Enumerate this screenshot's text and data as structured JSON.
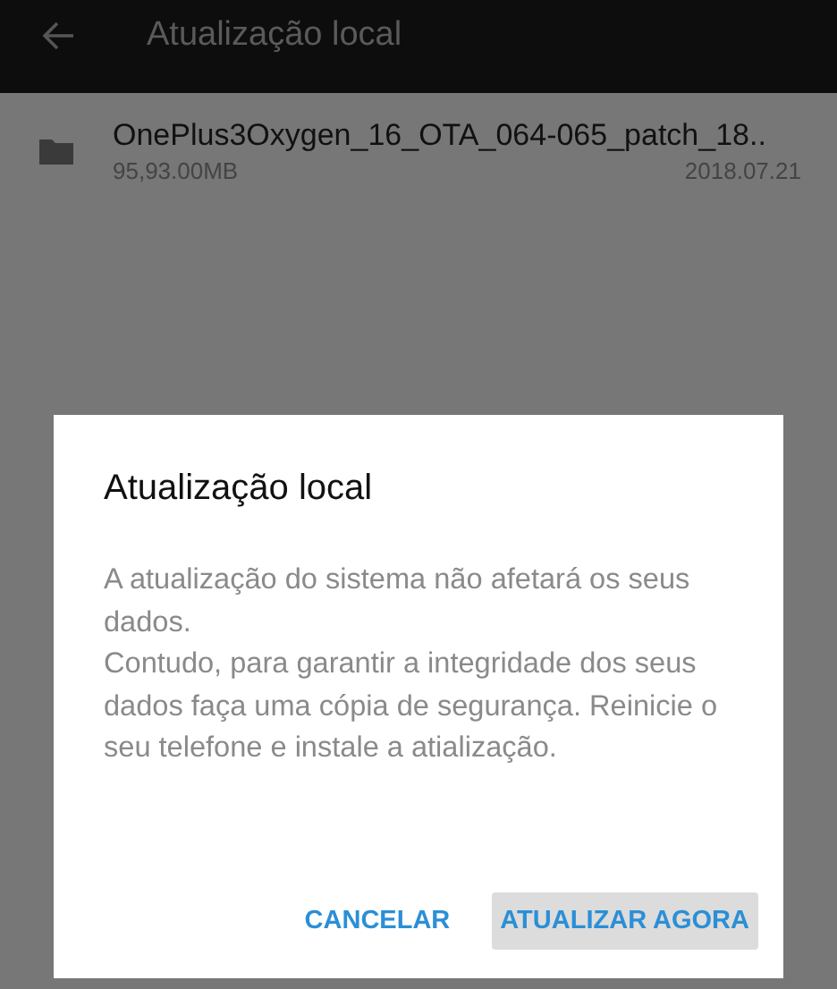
{
  "app_bar": {
    "title": "Atualização local"
  },
  "files": [
    {
      "name": "OnePlus3Oxygen_16_OTA_064-065_patch_18..",
      "size": "95,93.00MB",
      "date": "2018.07.21"
    }
  ],
  "dialog": {
    "title": "Atualização local",
    "message": "A atualização do sistema não afetará os seus dados.\nContudo, para garantir a integridade dos seus dados faça uma cópia de segurança. Reinicie o seu telefone e instale a atialização.",
    "buttons": [
      {
        "label": "CANCELAR",
        "pressed": false
      },
      {
        "label": "ATUALIZAR AGORA",
        "pressed": true
      }
    ]
  }
}
